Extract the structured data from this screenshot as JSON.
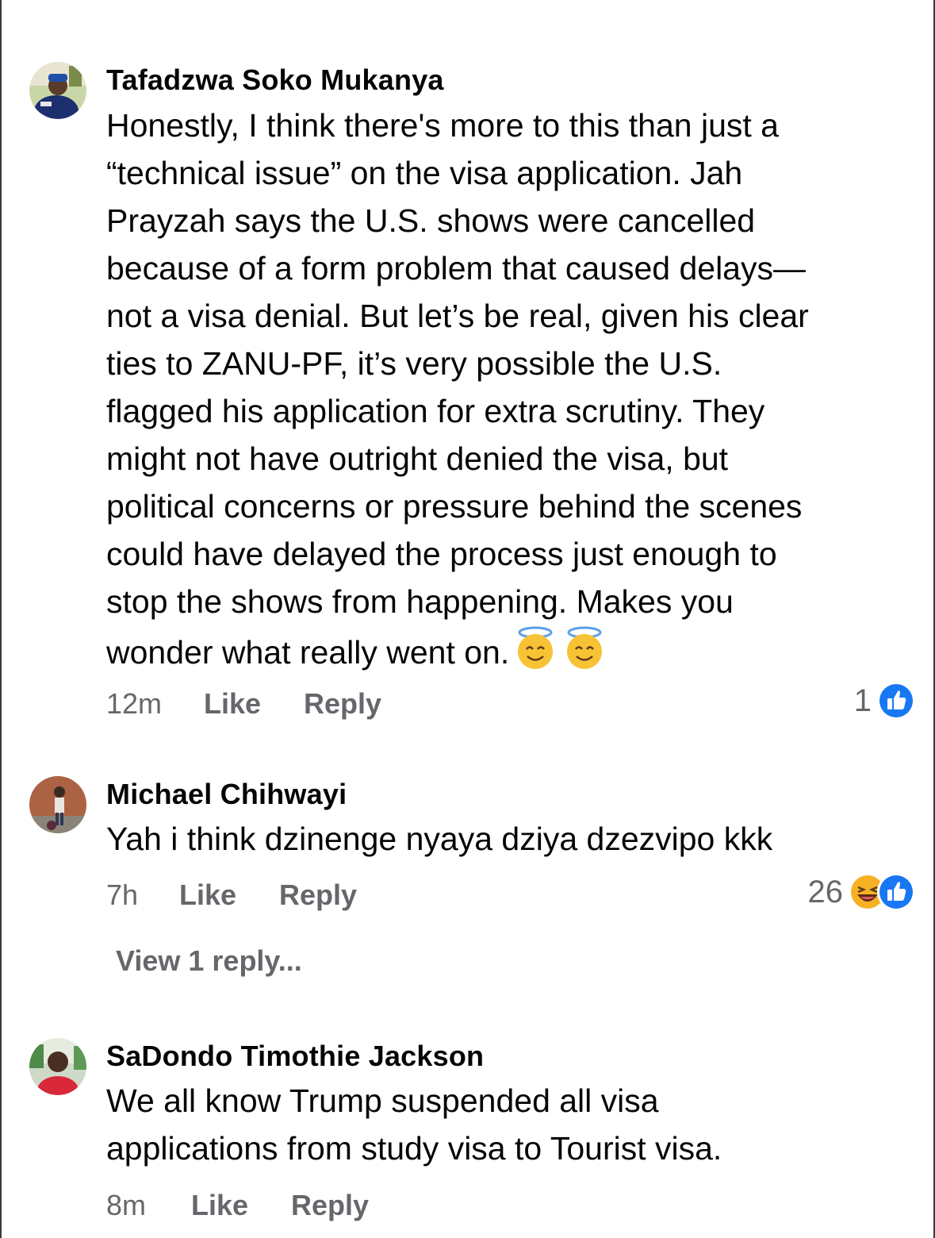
{
  "comments": [
    {
      "author": "Tafadzwa Soko Mukanya",
      "lines": [
        "Honestly, I think there's more to this than just a",
        "“technical issue” on the visa application. Jah",
        "Prayzah says the U.S. shows were cancelled",
        "because of a form problem that caused delays—",
        "not a visa denial. But let’s be real, given his clear",
        "ties to ZANU-PF, it’s very possible the U.S.",
        "flagged his application for extra scrutiny. They",
        "might not have outright denied the visa, but",
        "political concerns or pressure behind the scenes",
        "could have delayed the process just enough to",
        "stop the shows from happening. Makes you",
        "wonder what really went on."
      ],
      "trailing_emojis": [
        "smiling-face-with-halo",
        "smiling-face-with-halo"
      ],
      "time": "12m",
      "like_label": "Like",
      "reply_label": "Reply",
      "reaction_count": "1",
      "reactions": [
        "like"
      ]
    },
    {
      "author": "Michael Chihwayi",
      "lines": [
        "Yah i think dzinenge nyaya dziya dzezvipo kkk"
      ],
      "time": "7h",
      "like_label": "Like",
      "reply_label": "Reply",
      "reaction_count": "26",
      "reactions": [
        "haha",
        "like"
      ],
      "view_replies": "View 1 reply..."
    },
    {
      "author": "SaDondo Timothie Jackson",
      "lines": [
        "We all know Trump suspended all visa",
        "applications from study visa to Tourist visa."
      ],
      "time": "8m",
      "like_label": "Like",
      "reply_label": "Reply"
    }
  ],
  "colors": {
    "text_primary": "#050505",
    "text_secondary": "#65676b",
    "like_blue": "#1877f2",
    "haha_yellow": "#f7b125"
  }
}
